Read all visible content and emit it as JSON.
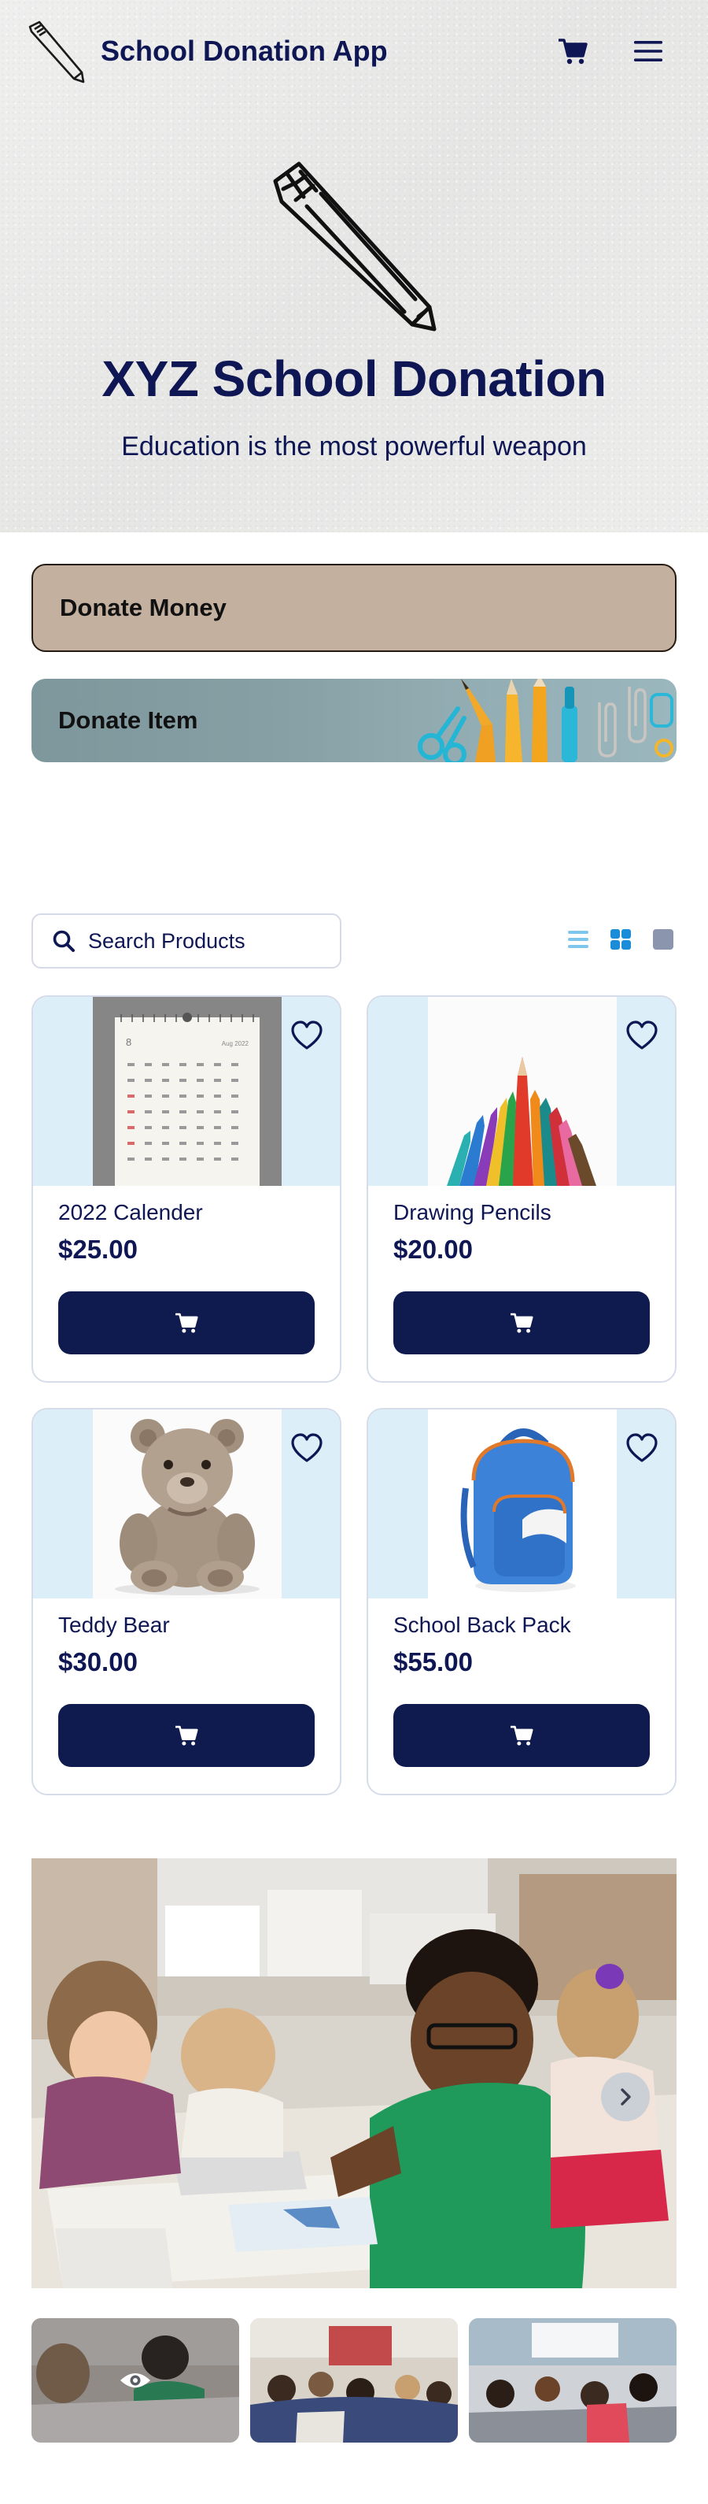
{
  "header": {
    "app_title": "School Donation App"
  },
  "hero": {
    "title": "XYZ School Donation",
    "subtitle": "Education is the most powerful weapon"
  },
  "donate": {
    "money_label": "Donate Money",
    "item_label": "Donate Item"
  },
  "search": {
    "placeholder": "Search Products"
  },
  "products": [
    {
      "name": "2022 Calender",
      "price": "$25.00"
    },
    {
      "name": "Drawing Pencils",
      "price": "$20.00"
    },
    {
      "name": "Teddy Bear",
      "price": "$30.00"
    },
    {
      "name": "School Back Pack",
      "price": "$55.00"
    }
  ],
  "calendar": {
    "month_number": "8",
    "month_label": "Aug 2022"
  },
  "icons": {
    "logo": "pencil-icon",
    "cart": "cart-icon",
    "menu": "hamburger-menu-icon",
    "search": "search-icon",
    "favorite": "heart-icon",
    "list_view": "list-view-icon",
    "grid_view": "grid-view-icon",
    "single_view": "single-view-icon",
    "gallery_next": "chevron-right-icon",
    "preview": "eye-icon"
  },
  "colors": {
    "brand_navy": "#0f1654",
    "button_navy": "#0f1a4e",
    "donate_money_bg": "#c4b09f",
    "donate_item_bg": "#87a0a5",
    "card_image_bg": "#dceef8",
    "toggle_active": "#1a8cd8"
  }
}
